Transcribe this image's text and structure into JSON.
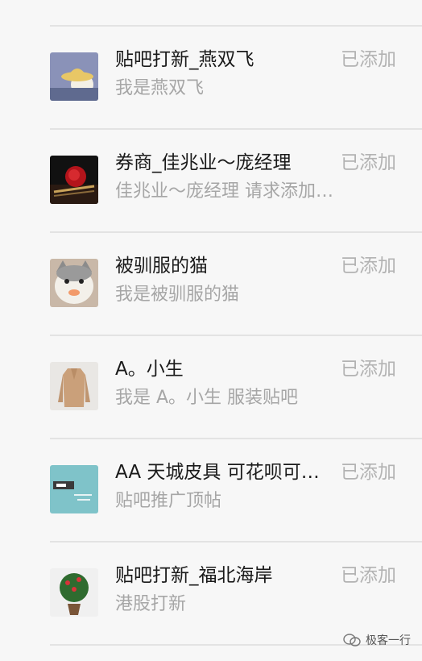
{
  "contacts": [
    {
      "name": "贴吧打新_燕双飞",
      "message": "我是燕双飞",
      "status": "已添加",
      "avatar": "cartoon-hat-icon"
    },
    {
      "name": "券商_佳兆业～庞经理",
      "message": "佳兆业～庞经理 请求添加…",
      "status": "已添加",
      "avatar": "red-rose-icon"
    },
    {
      "name": "被驯服的猫",
      "message": "我是被驯服的猫",
      "status": "已添加",
      "avatar": "cat-photo-icon"
    },
    {
      "name": "A。小生",
      "message": "我是 A。小生 服装贴吧",
      "status": "已添加",
      "avatar": "coat-photo-icon"
    },
    {
      "name": "AA 天城皮具 可花呗可…",
      "message": "贴吧推广顶帖",
      "status": "已添加",
      "avatar": "tiancheng-logo-icon"
    },
    {
      "name": "贴吧打新_福北海岸",
      "message": "港股打新",
      "status": "已添加",
      "avatar": "potted-plant-icon"
    }
  ],
  "watermark": {
    "text": "极客一行"
  }
}
